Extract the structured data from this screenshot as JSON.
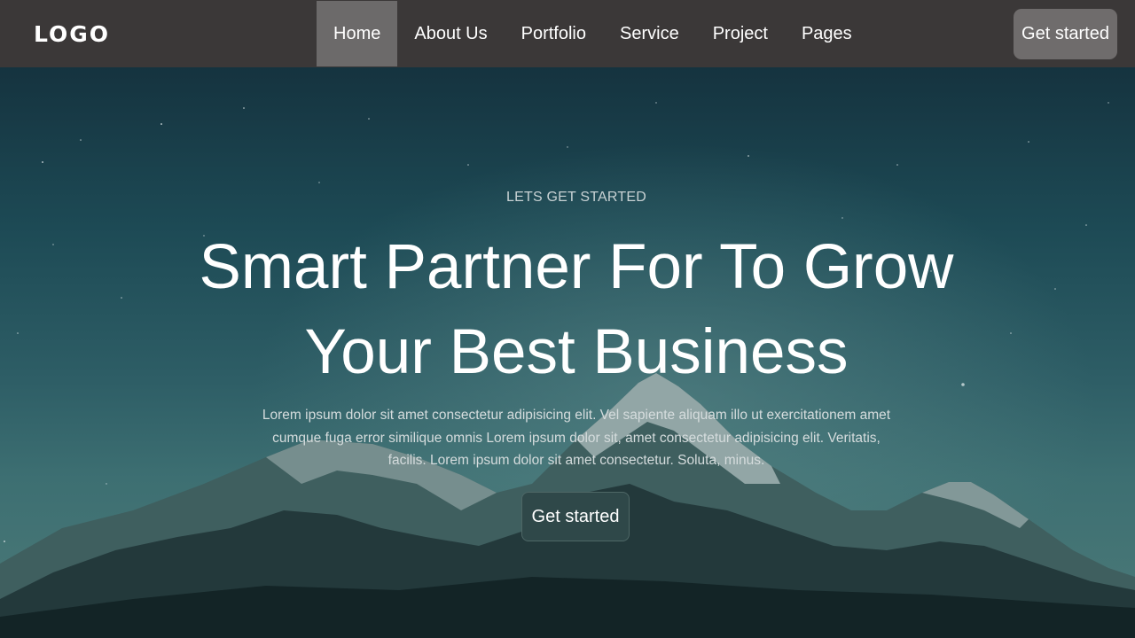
{
  "navbar": {
    "logo": "LOGO",
    "links": [
      {
        "label": "Home",
        "active": true
      },
      {
        "label": "About Us",
        "active": false
      },
      {
        "label": "Portfolio",
        "active": false
      },
      {
        "label": "Service",
        "active": false
      },
      {
        "label": "Project",
        "active": false
      },
      {
        "label": "Pages",
        "active": false
      }
    ],
    "cta_label": "Get started"
  },
  "hero": {
    "eyebrow": "LETS GET STARTED",
    "headline_line1": "Smart Partner For To Grow",
    "headline_line2": "Your Best Business",
    "description": "Lorem ipsum dolor sit amet consectetur adipisicing elit. Vel sapiente aliquam illo ut exercitationem amet cumque fuga error similique omnis Lorem ipsum dolor sit, amet consectetur adipisicing elit. Veritatis, facilis. Lorem ipsum dolor sit amet consectetur. Soluta, minus.",
    "cta_label": "Get started"
  },
  "colors": {
    "navbar_bg": "#3b3838",
    "nav_active_bg": "#6c6a6a",
    "hero_button_bg": "#2f4849"
  }
}
